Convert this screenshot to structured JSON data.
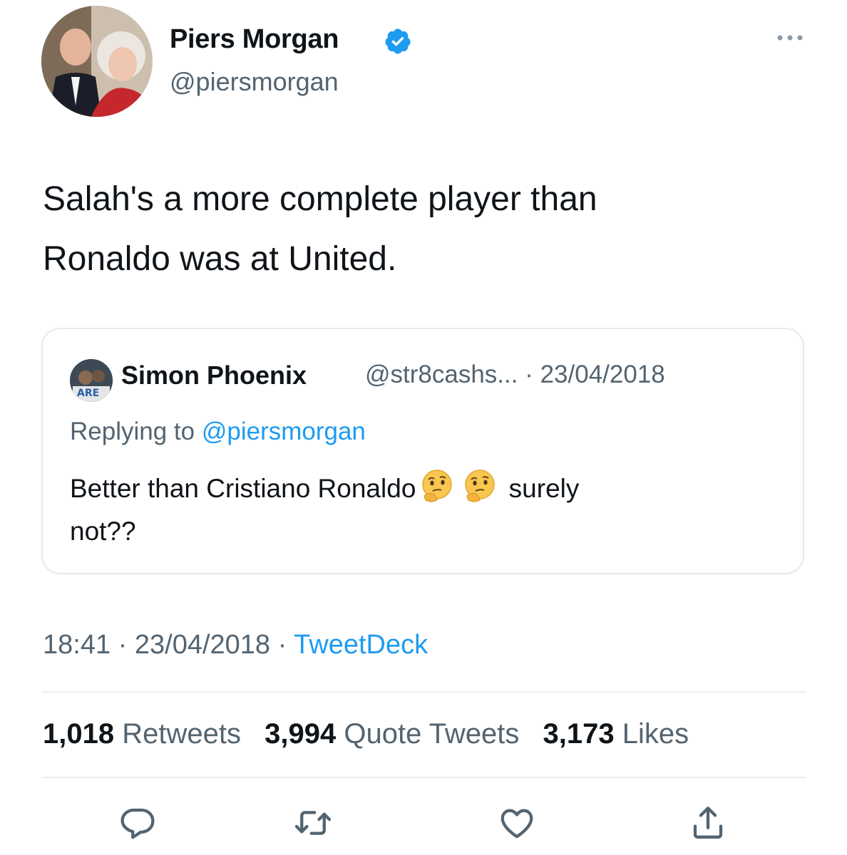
{
  "author": {
    "name": "Piers Morgan",
    "handle": "@piersmorgan",
    "verified": true,
    "avatar_icon": "profile-photo"
  },
  "tweet": {
    "text_line1": "Salah's a more complete player than",
    "text_line2": "Ronaldo was at United."
  },
  "quoted": {
    "name": "Simon Phoenix",
    "meta": "@str8cashs... · 23/04/2018",
    "replying_prefix": "Replying to ",
    "replying_mention": "@piersmorgan",
    "text_before": "Better than Cristiano Ronaldo",
    "emoji": "thinking-face",
    "text_after": " surely",
    "text_line2": "not??"
  },
  "timestamp": {
    "time_date": "18:41 · 23/04/2018 · ",
    "source": "TweetDeck"
  },
  "stats": {
    "retweets_count": "1,018",
    "retweets_label": "Retweets",
    "quotes_count": "3,994",
    "quotes_label": "Quote Tweets",
    "likes_count": "3,173",
    "likes_label": "Likes"
  },
  "actions": [
    "reply-icon",
    "retweet-icon",
    "like-icon",
    "share-icon"
  ],
  "colors": {
    "accent": "#1d9bf0",
    "secondary_text": "#536471",
    "primary_text": "#0f1419",
    "border": "#e6e9ec"
  }
}
